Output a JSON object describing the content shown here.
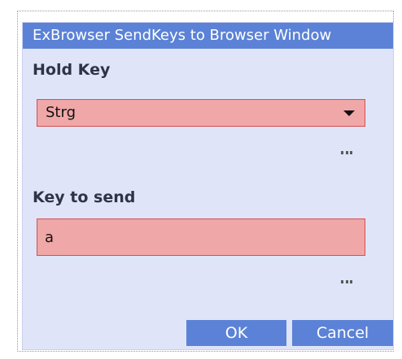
{
  "dialog": {
    "title": "ExBrowser SendKeys to Browser Window",
    "hold_key_label": "Hold Key",
    "hold_key_value": "Strg",
    "key_to_send_label": "Key to send",
    "key_to_send_value": "a",
    "ok_label": "OK",
    "cancel_label": "Cancel"
  },
  "icons": {
    "dropdown": "chevron-down-icon",
    "more": "ellipsis-icon"
  },
  "colors": {
    "titlebar": "#5b82d6",
    "dialog_background": "#dfe4f8",
    "invalid_field_fill": "#f0a7a7",
    "invalid_field_border": "#d25252",
    "button": "#5b82d6"
  }
}
